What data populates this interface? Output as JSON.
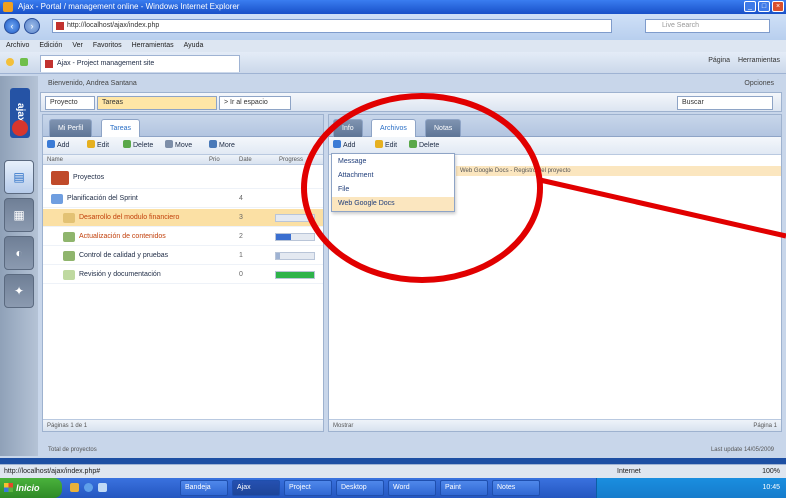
{
  "browser": {
    "title": "Ajax - Portal / management online - Windows Internet Explorer",
    "url": "http://localhost/ajax/index.php",
    "search_placeholder": "Live Search",
    "menu": [
      "Archivo",
      "Edición",
      "Ver",
      "Favoritos",
      "Herramientas",
      "Ayuda"
    ],
    "tab_label": "Ajax - Project management site",
    "tools": [
      "Página",
      "Herramientas"
    ]
  },
  "app": {
    "top_left": "Bienvenido, Andrea Santana",
    "top_right": "Opciones",
    "toolbar": {
      "combo1": "Proyecto",
      "combo2": "Tareas",
      "combo3": "> Ir al espacio",
      "combo_right": "Buscar"
    },
    "left_panel": {
      "tabs": [
        "Mi Perfil",
        "Tareas"
      ],
      "actions": [
        "Add",
        "Edit",
        "Delete",
        "Move",
        "More"
      ],
      "columns": [
        "Name",
        "Prio",
        "Date",
        "Progress"
      ],
      "rows": [
        {
          "label": "Proyectos",
          "num": "",
          "progress": 0
        },
        {
          "label": "Planificación del Sprint",
          "num": "4",
          "progress": 0
        },
        {
          "label": "Desarrollo del modulo financiero",
          "num": "3",
          "progress": 20
        },
        {
          "label": "Actualización de contenidos",
          "num": "2",
          "progress": 40
        },
        {
          "label": "Control de calidad y pruebas",
          "num": "1",
          "progress": 10
        },
        {
          "label": "Revisión y documentación",
          "num": "0",
          "progress": 100
        }
      ],
      "footer": "Páginas 1 de 1"
    },
    "right_panel": {
      "tabs": [
        "Info",
        "Archivos",
        "Notas"
      ],
      "actions": [
        "Add",
        "Edit",
        "Delete"
      ],
      "dropdown": [
        "Message",
        "Attachment",
        "File",
        "Web Google Docs"
      ],
      "highlight_text": "Web Google Docs - Registro del proyecto",
      "footer_left": "Mostrar",
      "footer_right": "Página 1"
    },
    "footer_left": "Total de proyectos",
    "footer_right": "Last update 14/05/2009"
  },
  "status": {
    "left": "http://localhost/ajax/index.php#",
    "zone": "Internet",
    "zoom": "100%"
  },
  "taskbar": {
    "start": "Inicio",
    "buttons": [
      "Bandeja",
      "Ajax",
      "Project",
      "Desktop",
      "Word",
      "Paint",
      "Notes"
    ],
    "tray": "10:45"
  },
  "colors": {
    "accent": "#2a6fc6",
    "annotation": "#e10000",
    "highlight": "#fbe6bf"
  }
}
